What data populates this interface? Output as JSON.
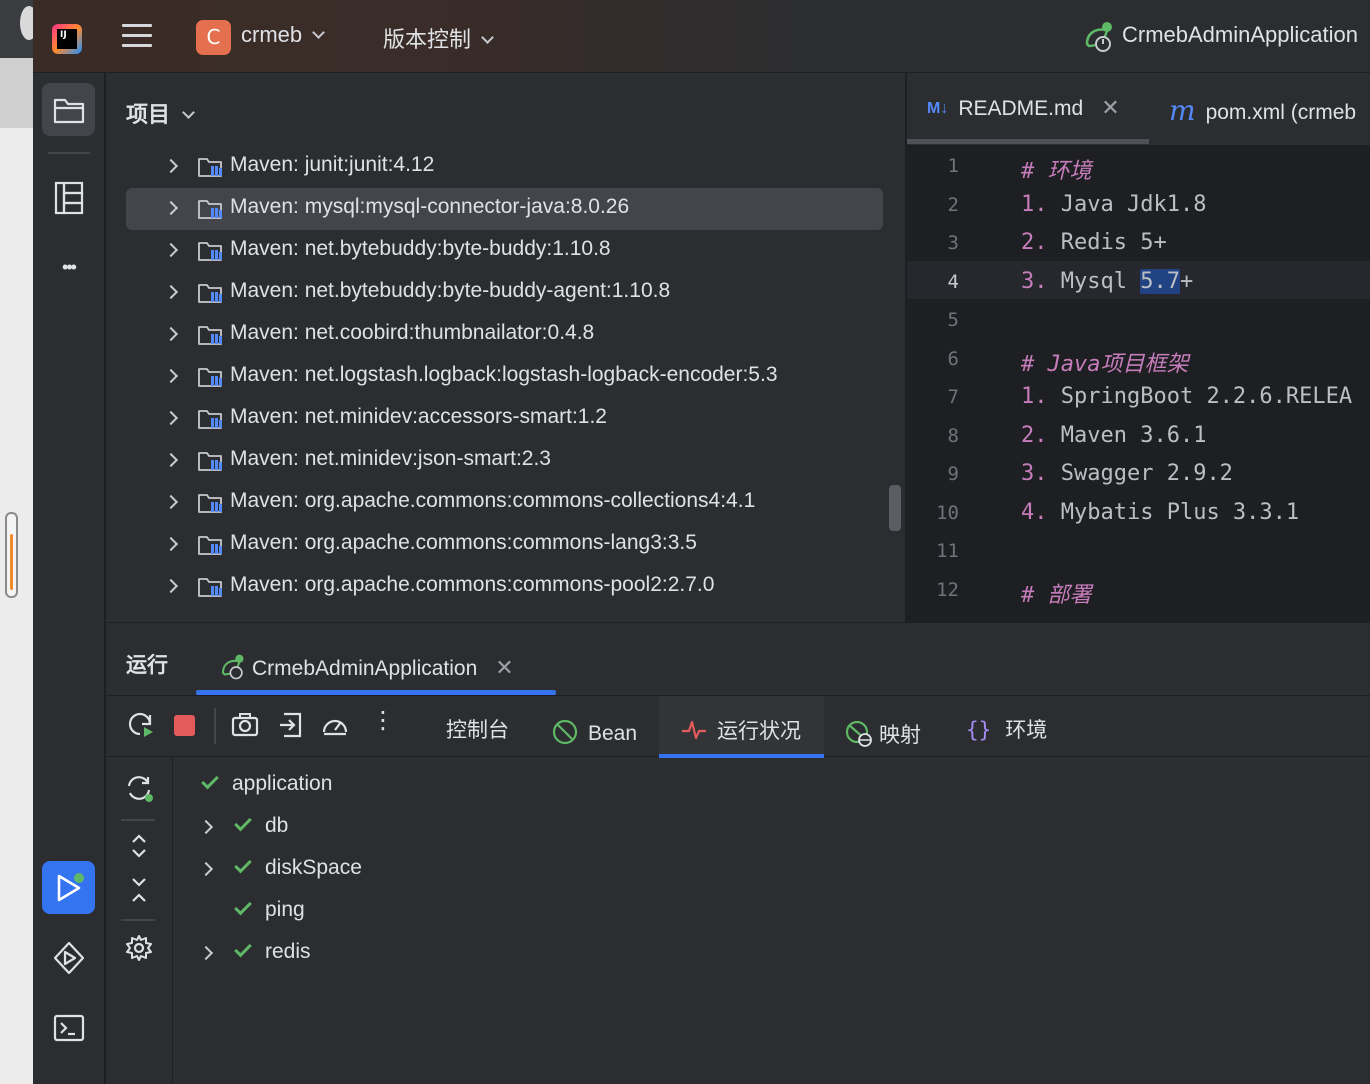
{
  "titlebar": {
    "logo_text": "IJ",
    "project_badge": "C",
    "project_name": "crmeb",
    "vcs_label": "版本控制",
    "run_config": "CrmebAdminApplication"
  },
  "toolstrip": {
    "items": [
      "folder-icon",
      "structure-icon",
      "more-icon",
      "run-icon",
      "services-icon",
      "terminal-icon"
    ],
    "more_label": "•••"
  },
  "project": {
    "title": "项目",
    "items": [
      {
        "label": "Maven: junit:junit:4.12",
        "selected": false
      },
      {
        "label": "Maven: mysql:mysql-connector-java:8.0.26",
        "selected": true
      },
      {
        "label": "Maven: net.bytebuddy:byte-buddy:1.10.8",
        "selected": false
      },
      {
        "label": "Maven: net.bytebuddy:byte-buddy-agent:1.10.8",
        "selected": false
      },
      {
        "label": "Maven: net.coobird:thumbnailator:0.4.8",
        "selected": false
      },
      {
        "label": "Maven: net.logstash.logback:logstash-logback-encoder:5.3",
        "selected": false
      },
      {
        "label": "Maven: net.minidev:accessors-smart:1.2",
        "selected": false
      },
      {
        "label": "Maven: net.minidev:json-smart:2.3",
        "selected": false
      },
      {
        "label": "Maven: org.apache.commons:commons-collections4:4.1",
        "selected": false
      },
      {
        "label": "Maven: org.apache.commons:commons-lang3:3.5",
        "selected": false
      },
      {
        "label": "Maven: org.apache.commons:commons-pool2:2.7.0",
        "selected": false
      }
    ]
  },
  "editor": {
    "tabs": [
      {
        "icon": "M↓",
        "label": "README.md",
        "close": "✕"
      },
      {
        "icon": "m",
        "label": "pom.xml (crmeb"
      }
    ],
    "current_line": 4,
    "lines": [
      {
        "n": "1",
        "hash": "#",
        "text": " 环境",
        "kind": "heading"
      },
      {
        "n": "2",
        "hash": "1.",
        "text": " Java Jdk1.8",
        "kind": "list"
      },
      {
        "n": "3",
        "hash": "2.",
        "text": " Redis 5+",
        "kind": "list"
      },
      {
        "n": "4",
        "hash": "3.",
        "text": " Mysql ",
        "sel": "5.7",
        "after": "+",
        "kind": "list"
      },
      {
        "n": "5",
        "hash": "",
        "text": "",
        "kind": "blank"
      },
      {
        "n": "6",
        "hash": "#",
        "text": " Java项目框架",
        "kind": "heading"
      },
      {
        "n": "7",
        "hash": "1.",
        "text": " SpringBoot 2.2.6.RELEA",
        "kind": "list"
      },
      {
        "n": "8",
        "hash": "2.",
        "text": " Maven 3.6.1",
        "kind": "list"
      },
      {
        "n": "9",
        "hash": "3.",
        "text": " Swagger 2.9.2",
        "kind": "list"
      },
      {
        "n": "10",
        "hash": "4.",
        "text": " Mybatis Plus 3.3.1",
        "kind": "list"
      },
      {
        "n": "11",
        "hash": "",
        "text": "",
        "kind": "blank"
      },
      {
        "n": "12",
        "hash": "#",
        "text": " 部署",
        "kind": "heading"
      }
    ]
  },
  "run": {
    "title": "运行",
    "tab_label": "CrmebAdminApplication",
    "tab_close": "✕",
    "toolbar_icons": [
      "rerun-icon",
      "stop-icon",
      "screenshot-icon",
      "restore-layout-icon",
      "profiler-icon",
      "more-vertical-icon"
    ],
    "more_label": "⋮",
    "subtabs": [
      {
        "icon": "console",
        "label": "控制台"
      },
      {
        "icon": "bean",
        "label": "Bean"
      },
      {
        "icon": "health",
        "label": "运行状况",
        "active": true
      },
      {
        "icon": "mapping",
        "label": "映射"
      },
      {
        "icon": "env",
        "label": "环境"
      }
    ],
    "env_icon_text": "{}",
    "health": [
      {
        "label": "application",
        "expandable": false,
        "level": 0
      },
      {
        "label": "db",
        "expandable": true,
        "level": 1
      },
      {
        "label": "diskSpace",
        "expandable": true,
        "level": 1
      },
      {
        "label": "ping",
        "expandable": false,
        "level": 1
      },
      {
        "label": "redis",
        "expandable": true,
        "level": 1
      }
    ]
  },
  "colors": {
    "accent": "#3574f0",
    "ok": "#5fb865",
    "stop": "#e55b5b",
    "markdown_keyword": "#c77dbb",
    "selection": "#214283"
  }
}
